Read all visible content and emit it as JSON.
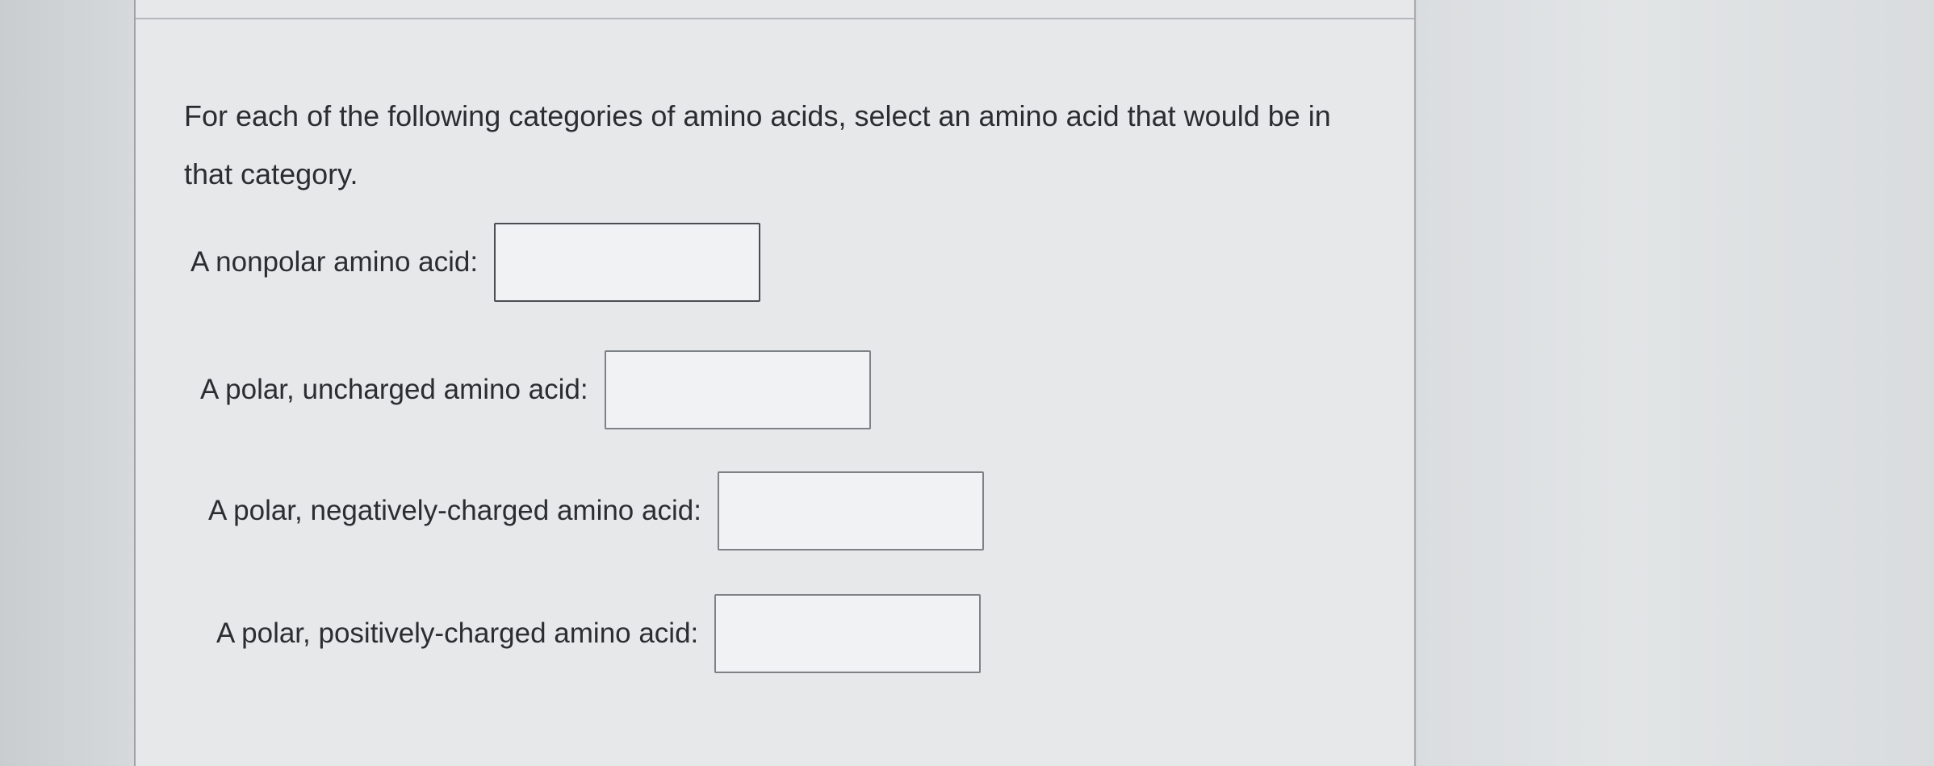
{
  "question": {
    "prompt": "For each of the following categories of amino acids, select an amino acid that would be in that category."
  },
  "fields": [
    {
      "label": "A nonpolar amino acid:",
      "value": ""
    },
    {
      "label": "A polar, uncharged amino acid:",
      "value": ""
    },
    {
      "label": "A polar, negatively-charged amino acid:",
      "value": ""
    },
    {
      "label": "A polar, positively-charged amino acid:",
      "value": ""
    }
  ]
}
